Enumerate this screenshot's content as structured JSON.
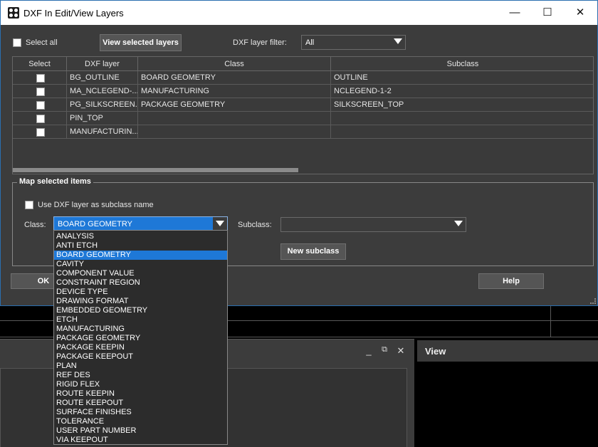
{
  "dialog": {
    "title": "DXF In Edit/View Layers",
    "window_controls": {
      "minimize": "—",
      "maximize": "☐",
      "close": "✕"
    },
    "select_all_label": "Select all",
    "view_selected_button": "View selected layers",
    "filter_label": "DXF layer filter:",
    "filter_value": "All",
    "table": {
      "columns": [
        "Select",
        "DXF layer",
        "Class",
        "Subclass"
      ],
      "rows": [
        {
          "layer": "BG_OUTLINE",
          "class": "BOARD GEOMETRY",
          "subclass": "OUTLINE"
        },
        {
          "layer": "MA_NCLEGEND-...",
          "class": "MANUFACTURING",
          "subclass": "NCLEGEND-1-2"
        },
        {
          "layer": "PG_SILKSCREEN...",
          "class": "PACKAGE GEOMETRY",
          "subclass": "SILKSCREEN_TOP"
        },
        {
          "layer": "PIN_TOP",
          "class": "",
          "subclass": ""
        },
        {
          "layer": "MANUFACTURIN...",
          "class": "",
          "subclass": ""
        }
      ]
    },
    "map_group": {
      "title": "Map selected items",
      "use_layer_label": "Use DXF layer as subclass name",
      "class_label": "Class:",
      "class_value": "BOARD GEOMETRY",
      "subclass_label": "Subclass:",
      "subclass_value": "",
      "new_subclass_button": "New subclass"
    },
    "ok_button": "OK",
    "help_button": "Help"
  },
  "class_dropdown": {
    "selected": "BOARD GEOMETRY",
    "options": [
      "ANALYSIS",
      "ANTI ETCH",
      "BOARD GEOMETRY",
      "CAVITY",
      "COMPONENT VALUE",
      "CONSTRAINT REGION",
      "DEVICE TYPE",
      "DRAWING FORMAT",
      "EMBEDDED GEOMETRY",
      "ETCH",
      "MANUFACTURING",
      "PACKAGE GEOMETRY",
      "PACKAGE KEEPIN",
      "PACKAGE KEEPOUT",
      "PLAN",
      "REF DES",
      "RIGID FLEX",
      "ROUTE KEEPIN",
      "ROUTE KEEPOUT",
      "SURFACE FINISHES",
      "TOLERANCE",
      "USER PART NUMBER",
      "VIA KEEPOUT"
    ]
  },
  "background": {
    "panel_controls": {
      "minimize": "_",
      "restore": "⧉",
      "close": "✕"
    },
    "view_panel_title": "View"
  },
  "colors": {
    "accent": "#1e78d7",
    "dialog_bg": "#3c3c3c",
    "titlebar_bg": "#ffffff"
  }
}
